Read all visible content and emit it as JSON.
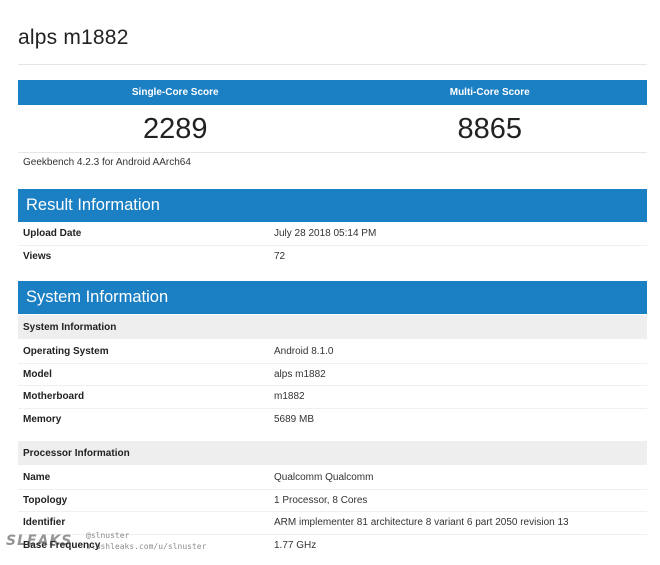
{
  "page": {
    "title": "alps m1882"
  },
  "scores": {
    "single_core_label": "Single-Core Score",
    "multi_core_label": "Multi-Core Score",
    "single_core_value": "2289",
    "multi_core_value": "8865",
    "version_text": "Geekbench 4.2.3 for Android AArch64"
  },
  "result_information": {
    "header": "Result Information",
    "rows": [
      {
        "key": "Upload Date",
        "value": "July 28 2018 05:14 PM"
      },
      {
        "key": "Views",
        "value": "72"
      }
    ]
  },
  "system_information": {
    "header": "System Information",
    "system_sub_header": "System Information",
    "system_rows": [
      {
        "key": "Operating System",
        "value": "Android 8.1.0"
      },
      {
        "key": "Model",
        "value": "alps m1882"
      },
      {
        "key": "Motherboard",
        "value": "m1882"
      },
      {
        "key": "Memory",
        "value": "5689 MB"
      }
    ],
    "processor_sub_header": "Processor Information",
    "processor_rows": [
      {
        "key": "Name",
        "value": "Qualcomm Qualcomm"
      },
      {
        "key": "Topology",
        "value": "1 Processor, 8 Cores"
      },
      {
        "key": "Identifier",
        "value": "ARM implementer 81 architecture 8 variant 6 part 2050 revision 13"
      },
      {
        "key": "Base Frequency",
        "value": "1.77 GHz"
      }
    ]
  },
  "watermark": {
    "logo": "SLEAKS",
    "user": "@slnuster",
    "url": "slashleaks.com/u/slnuster"
  }
}
